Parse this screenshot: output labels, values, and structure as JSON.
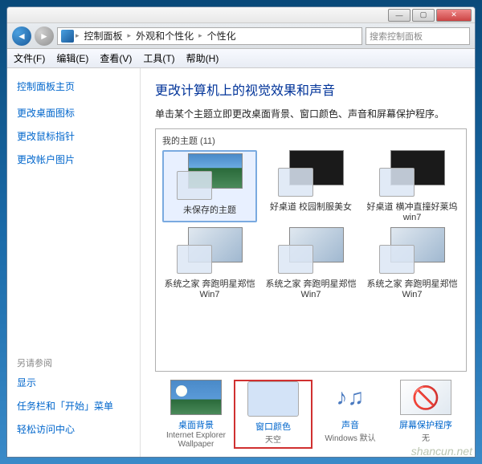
{
  "titlebar": {
    "min": "—",
    "max": "▢",
    "close": "✕"
  },
  "address": {
    "segments": [
      "控制面板",
      "外观和个性化",
      "个性化"
    ],
    "search_placeholder": "搜索控制面板"
  },
  "menu": {
    "file": "文件(F)",
    "edit": "编辑(E)",
    "view": "查看(V)",
    "tools": "工具(T)",
    "help": "帮助(H)"
  },
  "sidebar": {
    "home": "控制面板主页",
    "links": [
      "更改桌面图标",
      "更改鼠标指针",
      "更改帐户图片"
    ],
    "see_also": "另请参阅",
    "see_links": [
      "显示",
      "任务栏和「开始」菜单",
      "轻松访问中心"
    ]
  },
  "main": {
    "heading": "更改计算机上的视觉效果和声音",
    "subtitle": "单击某个主题立即更改桌面背景、窗口颜色、声音和屏幕保护程序。",
    "my_themes_label": "我的主题 (11)",
    "themes": [
      {
        "name": "未保存的主题",
        "style": "blue",
        "selected": true
      },
      {
        "name": "好桌道 校园制服美女",
        "style": "dark"
      },
      {
        "name": "好桌道 横冲直撞好莱坞win7",
        "style": "dark"
      },
      {
        "name": "系统之家 奔跑明星郑恺Win7",
        "style": "run"
      },
      {
        "name": "系统之家 奔跑明星郑恺Win7",
        "style": "run"
      },
      {
        "name": "系统之家 奔跑明星郑恺Win7",
        "style": "run"
      }
    ],
    "options": [
      {
        "label": "桌面背景",
        "sub": "Internet Explorer Wallpaper",
        "icon": "bg"
      },
      {
        "label": "窗口颜色",
        "sub": "天空",
        "icon": "color",
        "highlight": true
      },
      {
        "label": "声音",
        "sub": "Windows 默认",
        "icon": "sound"
      },
      {
        "label": "屏幕保护程序",
        "sub": "无",
        "icon": "saver"
      }
    ]
  },
  "watermark": "shancun.net"
}
